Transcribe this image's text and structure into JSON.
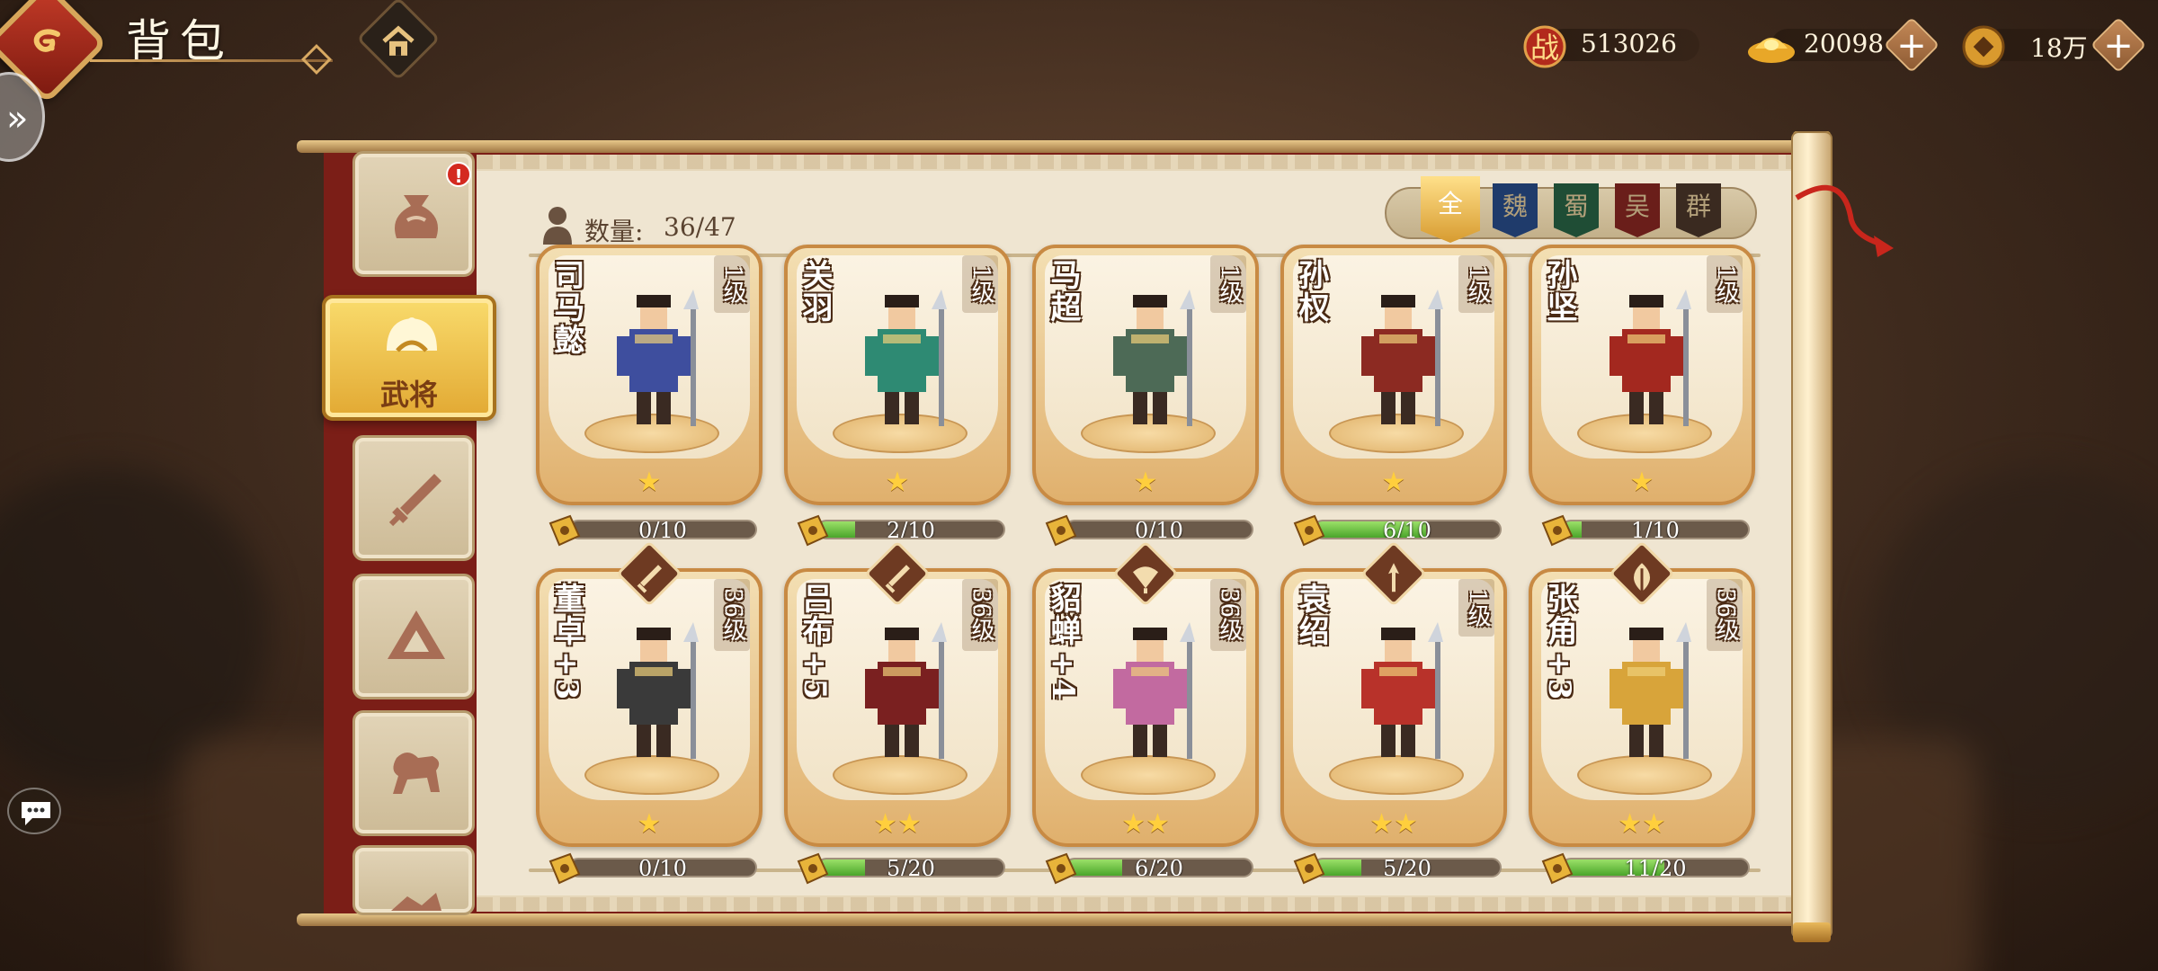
{
  "header": {
    "title": "背包",
    "resources": [
      {
        "name": "combat-power",
        "icon": "battle-power-icon",
        "label": "战",
        "value": "513026"
      },
      {
        "name": "gold-ingot",
        "icon": "gold-ingot-icon",
        "value": "20098"
      },
      {
        "name": "copper-coin",
        "icon": "copper-coin-icon",
        "value": "18万"
      }
    ]
  },
  "sidebar": {
    "tabs": [
      {
        "name": "bag",
        "icon": "money-bag-icon",
        "badge": "!"
      },
      {
        "name": "generals",
        "icon": "general-helmet-icon",
        "label": "武将",
        "active": true
      },
      {
        "name": "equipment",
        "icon": "sword-icon"
      },
      {
        "name": "treasure",
        "icon": "triangle-gem-icon"
      },
      {
        "name": "mount",
        "icon": "horse-icon"
      },
      {
        "name": "misc",
        "icon": "cavalry-icon"
      }
    ]
  },
  "inventory": {
    "count_label": "数量:",
    "count_value": "36/47",
    "factions": [
      {
        "label": "全",
        "color": "#d9a23a",
        "active": true
      },
      {
        "label": "魏",
        "color": "#1f3b6b"
      },
      {
        "label": "蜀",
        "color": "#1f4d35"
      },
      {
        "label": "吴",
        "color": "#6a1e1a"
      },
      {
        "label": "群",
        "color": "#3a2a20"
      }
    ]
  },
  "heroes": [
    {
      "name": "司马懿",
      "level": "1级",
      "stars": "★",
      "fragments": "0/10",
      "progress": 0,
      "robe": "#3e4e9e",
      "weapon": null
    },
    {
      "name": "关羽",
      "level": "1级",
      "stars": "★",
      "fragments": "2/10",
      "progress": 0.2,
      "robe": "#2e8a73",
      "weapon": null
    },
    {
      "name": "马超",
      "level": "1级",
      "stars": "★",
      "fragments": "0/10",
      "progress": 0,
      "robe": "#4d6a56",
      "weapon": null
    },
    {
      "name": "孙权",
      "level": "1级",
      "stars": "★",
      "fragments": "6/10",
      "progress": 0.6,
      "robe": "#8c2a22",
      "weapon": null
    },
    {
      "name": "孙坚",
      "level": "1级",
      "stars": "★",
      "fragments": "1/10",
      "progress": 0.1,
      "robe": "#a3281f",
      "weapon": null
    },
    {
      "name": "董卓",
      "level": "36级",
      "stars": "★",
      "fragments": "0/10",
      "progress": 0,
      "robe": "#3a3a3a",
      "weapon": "sword-icon",
      "plus": "+3"
    },
    {
      "name": "吕布",
      "level": "36级",
      "stars": "★★",
      "fragments": "5/20",
      "progress": 0.25,
      "robe": "#7a2020",
      "weapon": "sword-icon",
      "plus": "+5"
    },
    {
      "name": "貂蝉",
      "level": "36级",
      "stars": "★★",
      "fragments": "6/20",
      "progress": 0.3,
      "robe": "#c26aa0",
      "weapon": "fan-icon",
      "plus": "+4"
    },
    {
      "name": "袁绍",
      "level": "1级",
      "stars": "★★",
      "fragments": "5/20",
      "progress": 0.25,
      "robe": "#b8322a",
      "weapon": "spear-icon"
    },
    {
      "name": "张角",
      "level": "36级",
      "stars": "★★",
      "fragments": "11/20",
      "progress": 0.55,
      "robe": "#d8a43a",
      "weapon": "leaf-icon",
      "plus": "+3"
    }
  ]
}
